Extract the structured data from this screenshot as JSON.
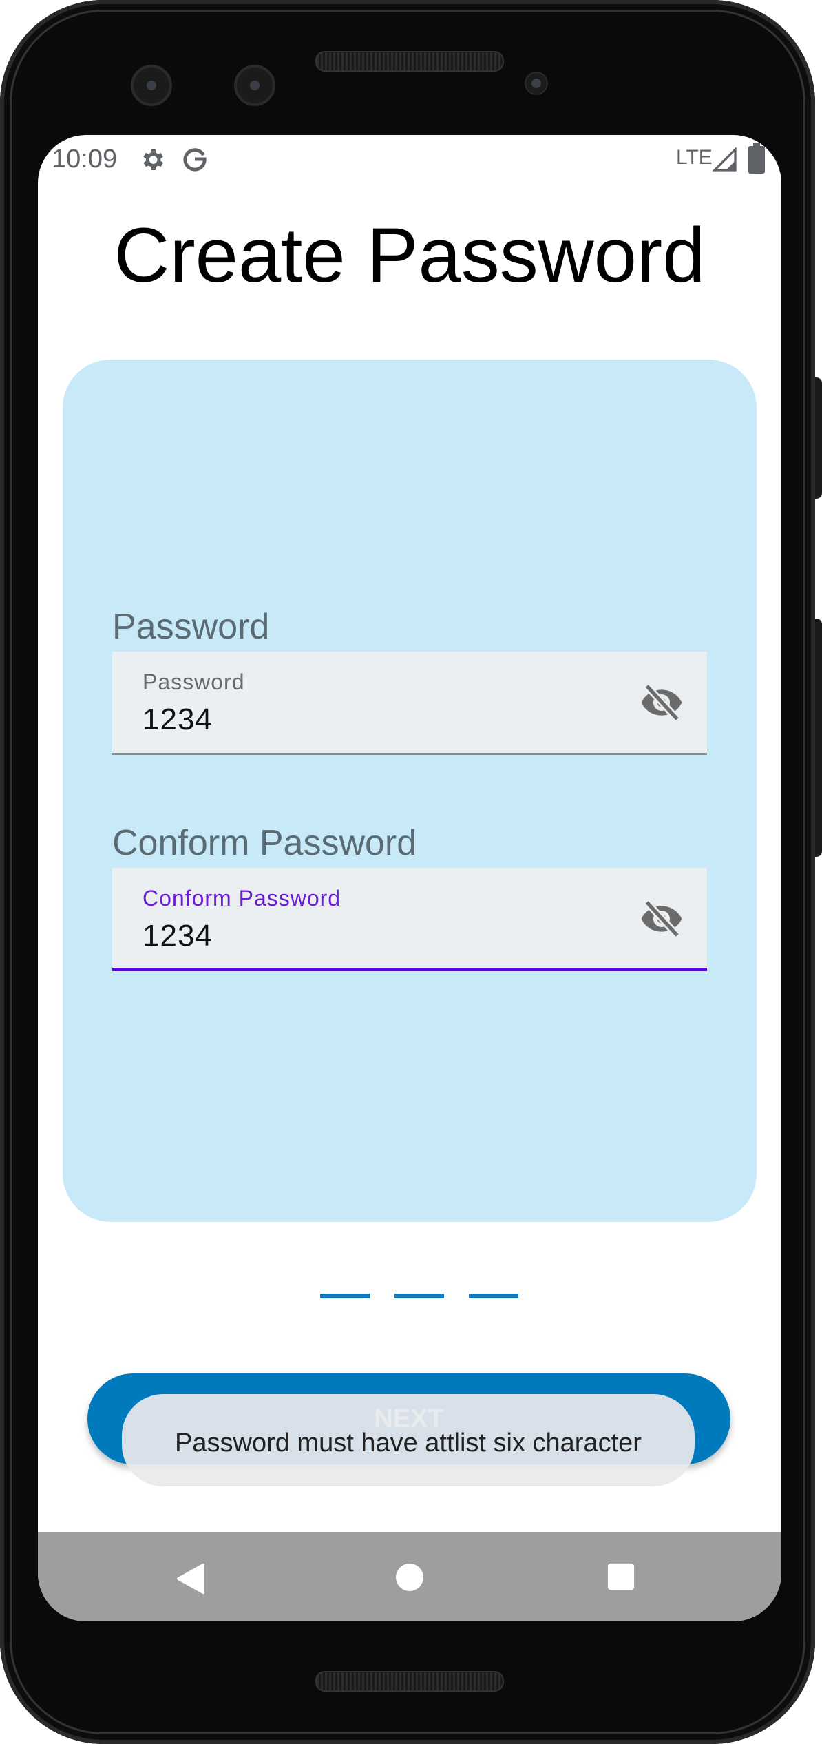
{
  "status_bar": {
    "time": "10:09",
    "icons": [
      "settings-icon",
      "google-icon"
    ],
    "network": "LTE",
    "right_icons": [
      "signal-icon",
      "battery-icon"
    ]
  },
  "page": {
    "title": "Create Password"
  },
  "form": {
    "password": {
      "heading": "Password",
      "label": "Password",
      "value": "1234",
      "toggle_icon": "visibility-off-icon"
    },
    "confirm_password": {
      "heading": "Conform Password",
      "label": "Conform Password",
      "value": "1234",
      "toggle_icon": "visibility-off-icon",
      "focused": true
    }
  },
  "pager": {
    "count": 3
  },
  "actions": {
    "next_label": "NEXT"
  },
  "toast": {
    "message": "Password must have attlist six character"
  },
  "nav_bar": {
    "icons": [
      "back-icon",
      "home-icon",
      "recents-icon"
    ]
  },
  "colors": {
    "card_bg": "#c7e9f8",
    "primary": "#0179bd",
    "focus_accent": "#6200ee",
    "field_bg": "#eceff1",
    "nav_bar": "#9e9e9e"
  }
}
